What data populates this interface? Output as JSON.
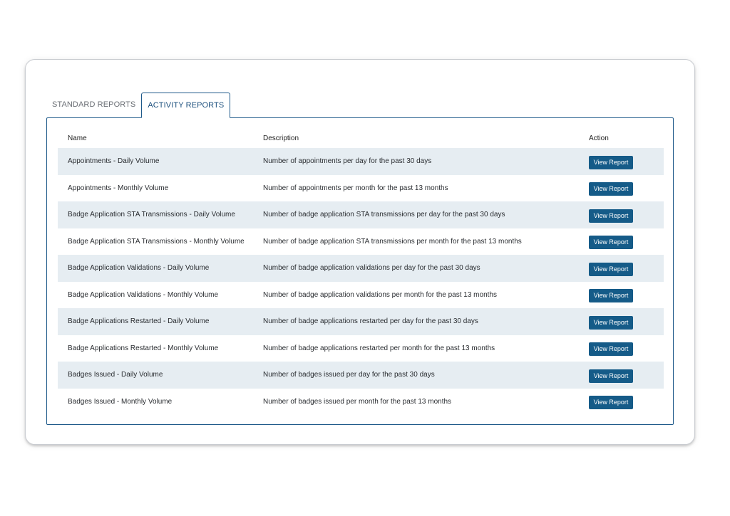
{
  "tabs": [
    {
      "label": "STANDARD REPORTS",
      "active": false
    },
    {
      "label": "ACTIVITY REPORTS",
      "active": true
    }
  ],
  "table": {
    "headers": {
      "name": "Name",
      "description": "Description",
      "action": "Action"
    },
    "button_label": "View Report",
    "rows": [
      {
        "name": "Appointments - Daily Volume",
        "description": "Number of appointments per day for the past 30 days"
      },
      {
        "name": "Appointments - Monthly Volume",
        "description": "Number of appointments per month for the past 13 months"
      },
      {
        "name": "Badge Application STA Transmissions - Daily Volume",
        "description": "Number of badge application STA transmissions per day for the past 30 days"
      },
      {
        "name": "Badge Application STA Transmissions - Monthly Volume",
        "description": "Number of badge application STA transmissions per month for the past 13 months"
      },
      {
        "name": "Badge Application Validations - Daily Volume",
        "description": "Number of badge application validations per day for the past 30 days"
      },
      {
        "name": "Badge Application Validations - Monthly Volume",
        "description": "Number of badge application validations per month for the past 13 months"
      },
      {
        "name": "Badge Applications Restarted - Daily Volume",
        "description": "Number of badge applications restarted per day for the past 30 days"
      },
      {
        "name": "Badge Applications Restarted - Monthly Volume",
        "description": "Number of badge applications restarted per month for the past 13 months"
      },
      {
        "name": "Badges Issued - Daily Volume",
        "description": "Number of badges issued per day for the past 30 days"
      },
      {
        "name": "Badges Issued - Monthly Volume",
        "description": "Number of badges issued per month for the past 13 months"
      }
    ]
  },
  "colors": {
    "accent": "#1f5a8a",
    "button": "#155b88",
    "row_alt": "#e6edf2"
  }
}
